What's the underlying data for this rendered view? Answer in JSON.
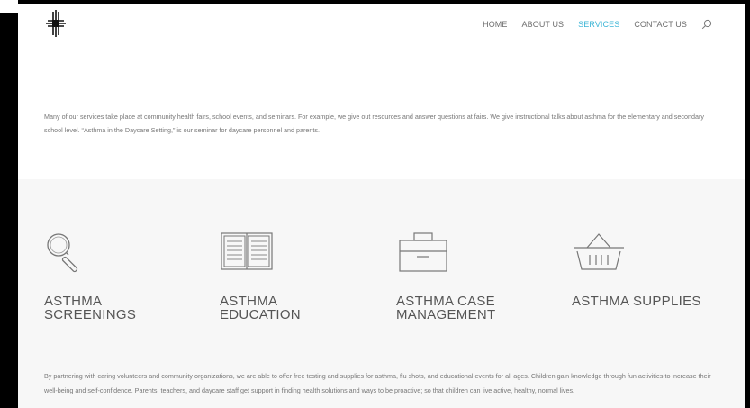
{
  "nav": {
    "items": [
      {
        "label": "HOME",
        "active": false
      },
      {
        "label": "ABOUT US",
        "active": false
      },
      {
        "label": "SERVICES",
        "active": true
      },
      {
        "label": "CONTACT US",
        "active": false
      }
    ],
    "search_icon": "search-icon"
  },
  "colors": {
    "accent": "#3bb5d6",
    "nav_text": "#6d6d6d",
    "section_bg": "#f7f7f7"
  },
  "intro": {
    "text": "Many of our services take place at community health fairs, school events, and seminars. For example, we give out resources and answer questions at fairs. We give instructional talks about asthma for the elementary and secondary school level. “Asthma in the Daycare Setting,” is our seminar for daycare personnel and parents."
  },
  "services": [
    {
      "icon": "magnifier-icon",
      "title_line1": "ASTHMA",
      "title_line2": "SCREENINGS"
    },
    {
      "icon": "book-icon",
      "title_line1": "ASTHMA",
      "title_line2": "EDUCATION"
    },
    {
      "icon": "briefcase-icon",
      "title_line1": "ASTHMA CASE",
      "title_line2": "MANAGEMENT"
    },
    {
      "icon": "basket-icon",
      "title_line1": "ASTHMA SUPPLIES",
      "title_line2": ""
    }
  ],
  "outro": {
    "text": "By partnering with caring volunteers and community organizations, we are able to offer free testing and supplies for asthma, flu shots, and educational events for all ages. Children gain knowledge through fun activities to increase their well-being and self-confidence. Parents, teachers, and daycare staff get support in finding health solutions and ways to be proactive; so that children can live active, healthy, normal lives."
  }
}
